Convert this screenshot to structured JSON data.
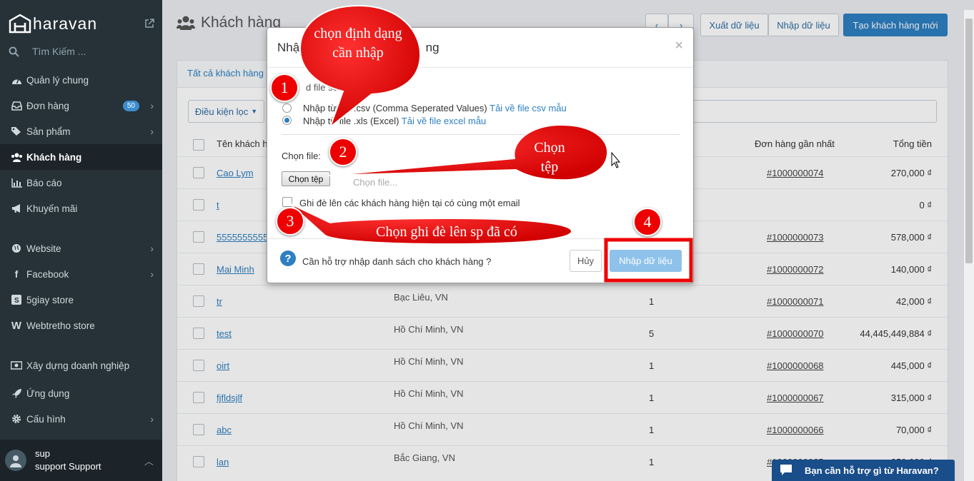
{
  "sidebar": {
    "brand": "haravan",
    "search_placeholder": "Tìm Kiếm ...",
    "items": [
      {
        "label": "Quản lý chung",
        "icon": "dashboard-icon"
      },
      {
        "label": "Đơn hàng",
        "icon": "inbox-icon",
        "badge": "50",
        "chevron": true
      },
      {
        "label": "Sản phẩm",
        "icon": "tag-icon",
        "chevron": true
      },
      {
        "label": "Khách hàng",
        "icon": "users-icon",
        "active": true
      },
      {
        "label": "Báo cáo",
        "icon": "bar-chart-icon"
      },
      {
        "label": "Khuyến mãi",
        "icon": "megaphone-icon"
      },
      {
        "label": "Website",
        "icon": "globe-icon",
        "chevron": true
      },
      {
        "label": "Facebook",
        "icon": "facebook-icon",
        "chevron": true
      },
      {
        "label": "5giay store",
        "icon": "5giay-icon"
      },
      {
        "label": "Webtretho store",
        "icon": "webtretho-icon"
      },
      {
        "label": "Xây dựng doanh nghiệp",
        "icon": "money-icon"
      },
      {
        "label": "Ứng dụng",
        "icon": "rocket-icon"
      },
      {
        "label": "Cấu hình",
        "icon": "gear-icon",
        "chevron": true
      }
    ],
    "user": {
      "name": "sup",
      "role": "support Support"
    }
  },
  "header": {
    "title": "Khách hàng",
    "export_label": "Xuất dữ liệu",
    "import_label": "Nhập dữ liệu",
    "create_label": "Tạo khách hàng mới"
  },
  "list": {
    "tab_all": "Tất cả khách hàng",
    "filter_label": "Điều kiện lọc",
    "columns": {
      "name": "Tên khách h",
      "last_order": "Đơn hàng gần nhất",
      "total": "Tổng tiền"
    },
    "rows": [
      {
        "name": "Cao Lym",
        "location": "",
        "orders": "",
        "last_order": "#1000000074",
        "total": "270,000 ₫"
      },
      {
        "name": "t",
        "location": "",
        "orders": "",
        "last_order": "",
        "total": "0 ₫"
      },
      {
        "name": "5555555555",
        "location": "",
        "orders": "",
        "last_order": "#1000000073",
        "total": "578,000 ₫"
      },
      {
        "name": "Mai Minh",
        "location": "",
        "orders": "",
        "last_order": "#1000000072",
        "total": "140,000 ₫"
      },
      {
        "name": "tr",
        "location": "Bạc Liêu, VN",
        "orders": "1",
        "last_order": "#1000000071",
        "total": "42,000 ₫"
      },
      {
        "name": "test",
        "location": "Hồ Chí Minh, VN",
        "orders": "5",
        "last_order": "#1000000070",
        "total": "44,445,449,884 ₫"
      },
      {
        "name": "oirt",
        "location": "Hồ Chí Minh, VN",
        "orders": "1",
        "last_order": "#1000000068",
        "total": "445,000 ₫"
      },
      {
        "name": "fjfldsjlf",
        "location": "Hồ Chí Minh, VN",
        "orders": "1",
        "last_order": "#1000000067",
        "total": "315,000 ₫"
      },
      {
        "name": "abc",
        "location": "Hồ Chí Minh, VN",
        "orders": "1",
        "last_order": "#1000000066",
        "total": "70,000 ₫"
      },
      {
        "name": "lan",
        "location": "Bắc Giang, VN",
        "orders": "1",
        "last_order": "#10000000?5",
        "total": "350,000 ₫"
      }
    ]
  },
  "modal": {
    "title": "Nhập",
    "title_tail": "ng",
    "choose_label": "d      file sẽ nhập:",
    "csv_text": "Nhập từ file .csv (Comma Seperated Values)",
    "csv_link": "Tải về file csv mẫu",
    "xls_text": "Nhập từ file .xls (Excel)",
    "xls_link": "Tải về file excel mẫu",
    "file_label": "Chọn file:",
    "file_button": "Chọn tệp",
    "file_placeholder": "Chọn file...",
    "overwrite_label": "Ghi đè lên các khách hàng hiện tại có cùng một email",
    "help_text": "Cần hỗ trợ nhập danh sách cho khách hàng ?",
    "cancel_label": "Hủy",
    "import_label": "Nhập dữ liệu"
  },
  "annotations": {
    "callout1": "chọn định dạng cần nhập",
    "callout2": "Chọn tệp",
    "callout3": "Chọn ghi đè lên sp đã có",
    "n1": "1",
    "n2": "2",
    "n3": "3",
    "n4": "4"
  },
  "chat": {
    "label": "Bạn cần hỗ trợ gì từ Haravan?"
  },
  "colors": {
    "sidebar": "#263238",
    "accent": "#2d7fc1",
    "annotation_red": "#e00000"
  }
}
